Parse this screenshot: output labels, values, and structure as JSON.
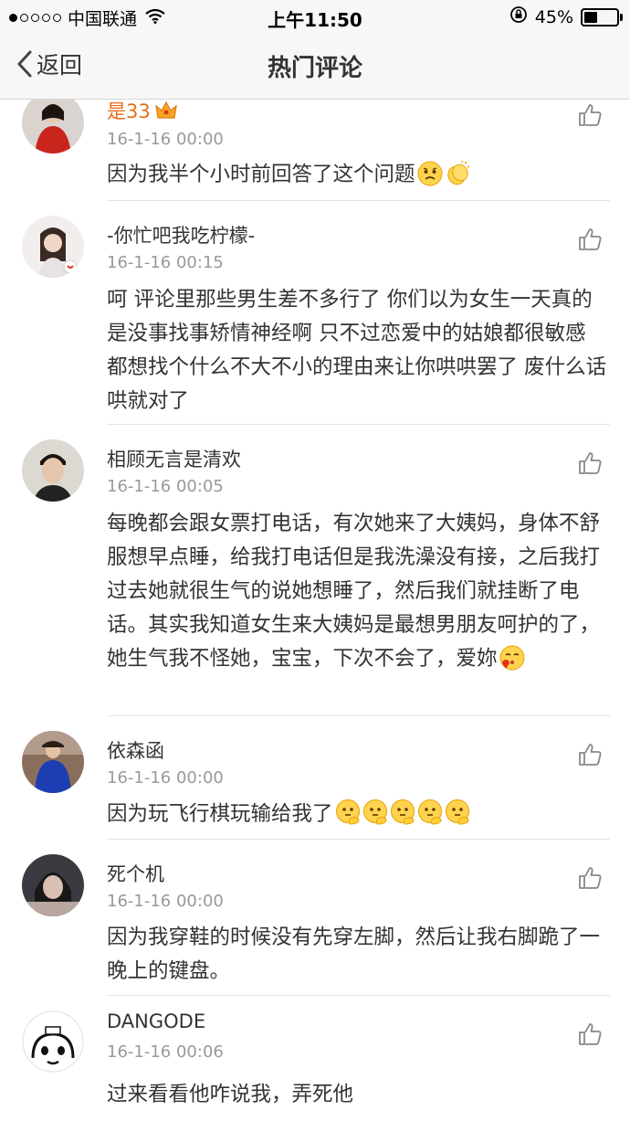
{
  "status_bar": {
    "carrier": "中国联通",
    "time": "上午11:50",
    "battery": "45%",
    "battery_level": 0.45
  },
  "nav": {
    "back_label": "返回",
    "title": "热门评论"
  },
  "comments": [
    {
      "user": "是33",
      "vip": true,
      "time": "16-1-16 00:00",
      "text": "因为我半个小时前回答了这个问题",
      "emojis": [
        "sad-face-icon",
        "applause-icon"
      ]
    },
    {
      "user": "-你忙吧我吃柠檬-",
      "time": "16-1-16 00:15",
      "text": "呵 评论里那些男生差不多行了 你们以为女生一天真的是没事找事矫情神经啊 只不过恋爱中的姑娘都很敏感 都想找个什么不大不小的理由来让你哄哄罢了 废什么话 哄就对了"
    },
    {
      "user": "相顾无言是清欢",
      "time": "16-1-16 00:05",
      "text": "每晚都会跟女票打电话，有次她来了大姨妈，身体不舒服想早点睡，给我打电话但是我洗澡没有接，之后我打过去她就很生气的说她想睡了，然后我们就挂断了电话。其实我知道女生来大姨妈是最想男朋友呵护的了，她生气我不怪她，宝宝，下次不会了，爱妳",
      "emojis": [
        "kiss-face-icon"
      ]
    },
    {
      "user": "依森函",
      "time": "16-1-16 00:00",
      "text": "因为玩飞行棋玩输给我了",
      "emojis": [
        "thinking-face-icon",
        "thinking-face-icon",
        "thinking-face-icon",
        "thinking-face-icon",
        "thinking-face-icon"
      ]
    },
    {
      "user": "死个机",
      "time": "16-1-16 00:00",
      "text": "因为我穿鞋的时候没有先穿左脚，然后让我右脚跪了一晚上的键盘。"
    },
    {
      "user": "DANGODE",
      "time": "16-1-16 00:06",
      "text": "过来看看他咋说我，弄死他"
    }
  ]
}
